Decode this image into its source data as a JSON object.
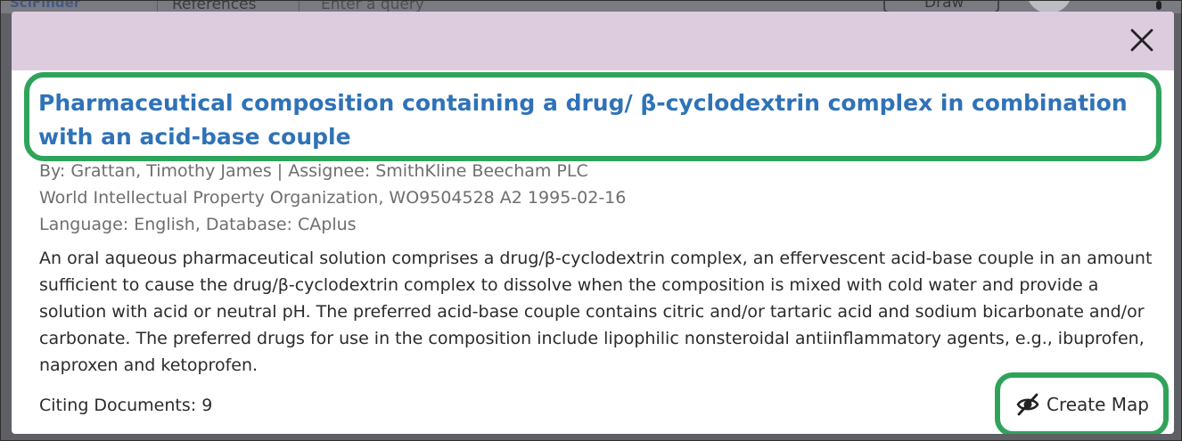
{
  "background": {
    "logo": "SciFinder",
    "tab": "References",
    "search_placeholder": "Enter a query",
    "draw_label": "Draw"
  },
  "modal": {
    "title": "Pharmaceutical composition containing a drug/ β-cyclodextrin complex in combination with an acid-base couple",
    "byline": "By: Grattan, Timothy James | Assignee: SmithKline Beecham PLC",
    "source": "World Intellectual Property Organization, WO9504528 A2 1995-02-16",
    "language": "Language: English, Database: CAplus",
    "abstract": "An oral aqueous pharmaceutical solution comprises a drug/β-cyclodextrin complex, an effervescent acid-base couple in an amount sufficient to cause the drug/β-cyclodextrin complex to dissolve when the composition is mixed with cold water and provide a solution with acid or neutral pH. The preferred acid-base couple contains citric and/or tartaric acid and sodium bicarbonate and/or carbonate. The preferred drugs for use in the composition include lipophilic nonsteroidal antiinflammatory agents, e.g., ibuprofen, naproxen and ketoprofen.",
    "citing": "Citing Documents: 9",
    "create_map_label": "Create Map"
  },
  "icons": {
    "close": "close-icon",
    "map": "map-icon"
  },
  "colors": {
    "header": "#dcccde",
    "title": "#2f72b8",
    "highlight": "#2fa35a"
  }
}
